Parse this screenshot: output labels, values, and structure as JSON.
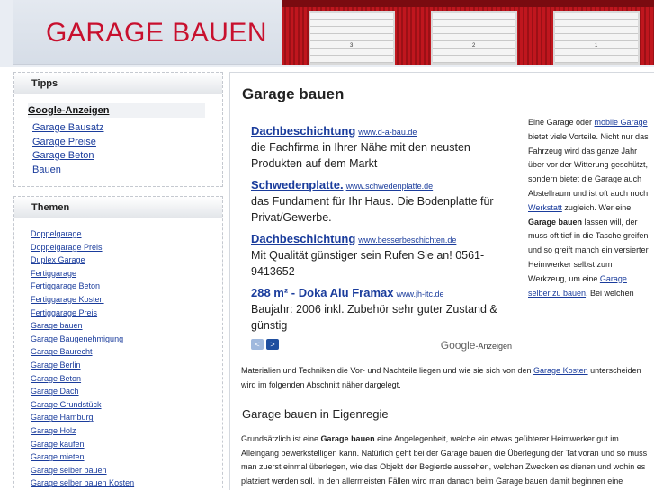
{
  "header": {
    "site_title": "GARAGE BAUEN",
    "door_numbers": [
      "3",
      "2",
      "1"
    ]
  },
  "tips": {
    "title": "Tipps",
    "ads_heading": "Google-Anzeigen",
    "links": [
      "Garage Bausatz",
      "Garage Preise",
      "Garage Beton",
      "Bauen"
    ]
  },
  "themen": {
    "title": "Themen",
    "links": [
      "Doppelgarage",
      "Doppelgarage Preis",
      "Duplex Garage",
      "Fertiggarage",
      "Fertiggarage Beton",
      "Fertiggarage Kosten",
      "Fertiggarage Preis",
      "Garage bauen",
      "Garage Baugenehmigung",
      "Garage Baurecht",
      "Garage Berlin",
      "Garage Beton",
      "Garage Dach",
      "Garage Grundstück",
      "Garage Hamburg",
      "Garage Holz",
      "Garage kaufen",
      "Garage mieten",
      "Garage selber bauen",
      "Garage selber bauen Kosten"
    ]
  },
  "main": {
    "title": "Garage bauen",
    "ads": [
      {
        "title": "Dachbeschichtung",
        "url": "www.d-a-bau.de",
        "text": "die Fachfirma in Ihrer Nähe mit den neusten Produkten auf dem Markt"
      },
      {
        "title": "Schwedenplatte.",
        "url": "www.schwedenplatte.de",
        "text": "das Fundament für Ihr Haus. Die Bodenplatte für Privat/Gewerbe."
      },
      {
        "title": "Dachbeschichtung",
        "url": "www.besserbeschichten.de",
        "text": "Mit Qualität günstiger sein Rufen Sie an! 0561-9413652"
      },
      {
        "title": "288 m² - Doka Alu Framax",
        "url": "www.jh-itc.de",
        "text": "Baujahr: 2006 inkl. Zubehör sehr guter Zustand & günstig"
      }
    ],
    "nav_prev": "<",
    "nav_next": ">",
    "google_label": "Google",
    "google_suffix": "-Anzeigen",
    "side": {
      "t1": "Eine Garage oder ",
      "l1": "mobile Garage",
      "t2": " bietet viele Vorteile. Nicht nur das Fahrzeug wird das ganze Jahr über vor der Witterung geschützt, sondern bietet die Garage auch Abstellraum und ist oft auch noch ",
      "l2": "Werkstatt",
      "t3": " zugleich. Wer eine ",
      "b1": "Garage bauen",
      "t4": " lassen will, der muss oft tief in die Tasche greifen und so greift manch ein versierter Heimwerker selbst zum Werkzeug, um eine ",
      "l3": "Garage selber zu bauen",
      "t5": ". Bei welchen"
    },
    "cont": {
      "t1": "Materialien und Techniken die Vor- und Nachteile liegen und wie sie sich von den ",
      "l1": "Garage Kosten",
      "t2": " unterscheiden wird im folgenden Abschnitt näher dargelegt."
    },
    "subheading": "Garage bauen in Eigenregie",
    "para2": {
      "t1": "Grundsätzlich ist eine ",
      "b1": "Garage bauen",
      "t2": " eine Angelegenheit, welche ein etwas geübterer Heimwerker gut im Alleingang bewerkstelligen kann. Natürlich geht bei der Garage bauen die Überlegung der Tat voran und so muss man zuerst einmal überlegen, wie das Objekt der Begierde aussehen, welchen Zwecken es dienen und wohin es platziert werden soll. In den allermeisten Fällen wird man danach beim Garage bauen damit beginnen eine Betonplatte zu gießen."
    }
  }
}
